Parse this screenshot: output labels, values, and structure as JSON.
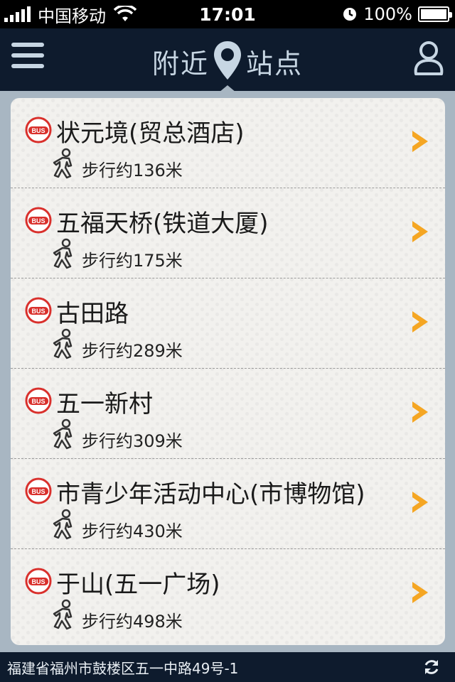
{
  "status_bar": {
    "carrier": "中国移动",
    "time": "17:01",
    "battery": "100%",
    "icons": [
      "signal-icon",
      "wifi-icon",
      "alarm-icon",
      "battery-icon"
    ]
  },
  "nav": {
    "title_left": "附近",
    "title_right": "站点",
    "icons": [
      "menu-icon",
      "location-pin-icon",
      "user-icon"
    ]
  },
  "stops": [
    {
      "name": "状元境(贸总酒店)",
      "distance": "步行约136米"
    },
    {
      "name": "五福天桥(铁道大厦)",
      "distance": "步行约175米"
    },
    {
      "name": "古田路",
      "distance": "步行约289米"
    },
    {
      "name": "五一新村",
      "distance": "步行约309米"
    },
    {
      "name": "市青少年活动中心(市博物馆)",
      "distance": "步行约430米"
    },
    {
      "name": "于山(五一广场)",
      "distance": "步行约498米"
    }
  ],
  "footer": {
    "address": "福建省福州市鼓楼区五一中路49号-1",
    "icon": "refresh-icon"
  },
  "colors": {
    "nav_bg": "#0e1b2d",
    "nav_fg": "#c7d6e3",
    "accent": "#f5a623",
    "bus_red": "#d9302c",
    "page_bg": "#a8b6c2"
  }
}
